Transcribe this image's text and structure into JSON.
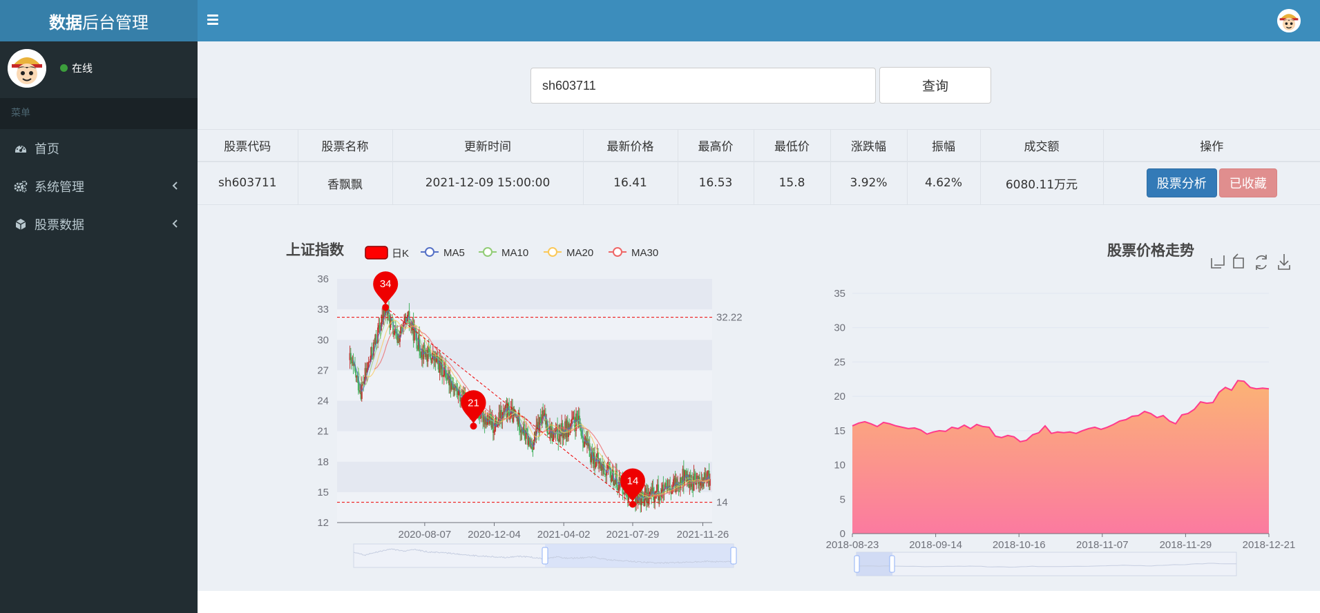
{
  "header": {
    "brand_bold": "数据",
    "brand_light": "后台管理"
  },
  "sidebar": {
    "status": "在线",
    "menu_header": "菜单",
    "items": [
      {
        "label": "首页",
        "icon": "dashboard-icon",
        "has_chevron": false
      },
      {
        "label": "系统管理",
        "icon": "cogs-icon",
        "has_chevron": true
      },
      {
        "label": "股票数据",
        "icon": "cube-icon",
        "has_chevron": true
      }
    ]
  },
  "search": {
    "value": "sh603711",
    "button": "查询"
  },
  "table": {
    "headers": [
      "股票代码",
      "股票名称",
      "更新时间",
      "最新价格",
      "最高价",
      "最低价",
      "涨跌幅",
      "振幅",
      "成交额",
      "操作"
    ],
    "row": [
      "sh603711",
      "香飘飘",
      "2021-12-09 15:00:00",
      "16.41",
      "16.53",
      "15.8",
      "3.92%",
      "4.62%",
      "6080.11万元"
    ],
    "analyze_button": "股票分析",
    "favorite_button": "已收藏"
  },
  "chart_data": [
    {
      "type": "candlestick",
      "title": "上证指数",
      "legend": [
        "日K",
        "MA5",
        "MA10",
        "MA20",
        "MA30"
      ],
      "legend_colors": [
        "#ff0000",
        "#5470c6",
        "#91cc75",
        "#fac858",
        "#ee6666"
      ],
      "ylim": [
        12,
        36
      ],
      "yticks": [
        12,
        15,
        18,
        21,
        24,
        27,
        30,
        33,
        36
      ],
      "xticks": [
        "2020-08-07",
        "2020-12-04",
        "2021-04-02",
        "2021-07-29",
        "2021-11-26"
      ],
      "markpoints": [
        34,
        21,
        14
      ],
      "marklines": [
        32.22,
        14
      ],
      "close_path": [
        [
          "2020-04-01",
          28
        ],
        [
          "2020-04-20",
          25
        ],
        [
          "2020-05-10",
          29
        ],
        [
          "2020-06-01",
          33
        ],
        [
          "2020-06-20",
          30
        ],
        [
          "2020-07-10",
          32
        ],
        [
          "2020-08-01",
          29
        ],
        [
          "2020-08-25",
          28
        ],
        [
          "2020-09-15",
          26.5
        ],
        [
          "2020-10-05",
          24.5
        ],
        [
          "2020-10-25",
          23.5
        ],
        [
          "2020-11-15",
          22.5
        ],
        [
          "2020-12-04",
          21.5
        ],
        [
          "2020-12-25",
          23
        ],
        [
          "2021-01-15",
          22
        ],
        [
          "2021-02-05",
          19.5
        ],
        [
          "2021-02-25",
          22.5
        ],
        [
          "2021-03-15",
          20.5
        ],
        [
          "2021-04-02",
          21
        ],
        [
          "2021-04-25",
          22
        ],
        [
          "2021-05-15",
          19
        ],
        [
          "2021-06-05",
          17.5
        ],
        [
          "2021-06-25",
          16.5
        ],
        [
          "2021-07-15",
          15.5
        ],
        [
          "2021-07-29",
          14.5
        ],
        [
          "2021-08-20",
          14.5
        ],
        [
          "2021-09-10",
          15
        ],
        [
          "2021-10-01",
          15
        ],
        [
          "2021-10-20",
          16.5
        ],
        [
          "2021-11-10",
          16
        ],
        [
          "2021-11-26",
          16
        ],
        [
          "2021-12-09",
          16.41
        ]
      ]
    },
    {
      "type": "area",
      "title": "股票价格走势",
      "toolbox_icons": [
        "zoom-icon",
        "zoom-reset-icon",
        "restore-icon",
        "download-icon"
      ],
      "ylim": [
        0,
        35
      ],
      "yticks": [
        0,
        5,
        10,
        15,
        20,
        25,
        30,
        35
      ],
      "xticks": [
        "2018-08-23",
        "2018-09-14",
        "2018-10-16",
        "2018-11-07",
        "2018-11-29",
        "2018-12-21"
      ],
      "series": [
        {
          "values": [
            15.7,
            16.1,
            16.3,
            16.0,
            15.6,
            16.2,
            16.0,
            15.7,
            15.5,
            15.3,
            15.4,
            15.1,
            14.5,
            14.8,
            15.0,
            14.9,
            15.5,
            15.3,
            15.8,
            15.3,
            15.9,
            15.6,
            15.5,
            14.2,
            14.0,
            14.3,
            14.1,
            13.4,
            13.6,
            14.4,
            14.7,
            15.7,
            14.6,
            14.8,
            14.7,
            14.8,
            14.6,
            15.0,
            15.3,
            15.5,
            15.2,
            15.5,
            15.9,
            16.4,
            16.6,
            17.1,
            17.2,
            17.8,
            17.5,
            16.9,
            17.2,
            16.4,
            16.0,
            17.3,
            17.5,
            18.1,
            19.2,
            19.0,
            19.1,
            20.6,
            21.3,
            20.9,
            22.3,
            22.2,
            21.3,
            21.1,
            21.2,
            21.1
          ]
        }
      ]
    }
  ]
}
